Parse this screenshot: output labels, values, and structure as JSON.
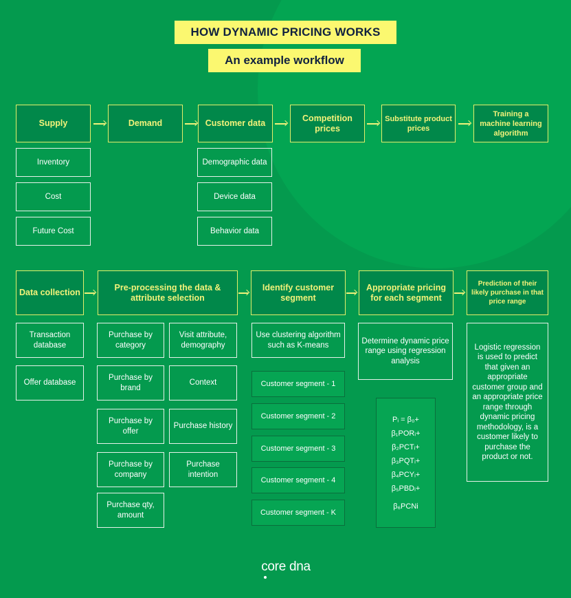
{
  "title": "HOW DYNAMIC PRICING WORKS",
  "subtitle": "An example workflow",
  "colors": {
    "background": "#049a4e",
    "highlight_circle": "#03a552",
    "title_bg": "#fbf870",
    "title_text": "#10213f",
    "header_fill": "#01884a",
    "header_text": "#f3f27a",
    "segment_fill": "#06a553"
  },
  "row1": {
    "steps": [
      {
        "label": "Supply",
        "details": [
          "Inventory",
          "Cost",
          "Future Cost"
        ]
      },
      {
        "label": "Demand",
        "details": []
      },
      {
        "label": "Customer data",
        "details": [
          "Demographic data",
          "Device data",
          "Behavior data"
        ]
      },
      {
        "label": "Competition prices",
        "details": []
      },
      {
        "label": "Substitute product prices",
        "details": []
      },
      {
        "label": "Training a machine learning algorithm",
        "details": []
      }
    ]
  },
  "row2": {
    "steps": [
      {
        "label": "Data collection",
        "details": [
          "Transaction database",
          "Offer database"
        ]
      },
      {
        "label": "Pre-processing the data & attribute selection",
        "details_left": [
          "Purchase by category",
          "Purchase by brand",
          "Purchase by offer",
          "Purchase by company",
          "Purchase qty, amount"
        ],
        "details_right": [
          "Visit attribute, demography",
          "Context",
          "Purchase history",
          "Purchase intention"
        ]
      },
      {
        "label": "Identify customer segment",
        "details": [
          "Use clustering algorithm such as K-means"
        ],
        "segments": [
          "Customer segment - 1",
          "Customer segment - 2",
          "Customer segment - 3",
          "Customer segment - 4",
          "Customer segment - K"
        ]
      },
      {
        "label": "Appropriate pricing for each segment",
        "details": [
          "Determine dynamic price range using regression analysis"
        ],
        "formula": [
          "Pᵢ = β₀+",
          "β₁PORᵢ+",
          "β₂PCTᵢ+",
          "β₃PQTᵢ+",
          "β₄PCYᵢ+",
          "β₅PBDᵢ+",
          "β₆PCNi"
        ]
      },
      {
        "label": "Prediction of their likely purchase in that price range",
        "details": [
          "Logistic regression is used to predict that given an appropriate customer group and an appropriate price range through dynamic pricing methodology, is a customer likely to purchase the product or not."
        ]
      }
    ]
  },
  "footer": {
    "logo_text": "core dna"
  }
}
